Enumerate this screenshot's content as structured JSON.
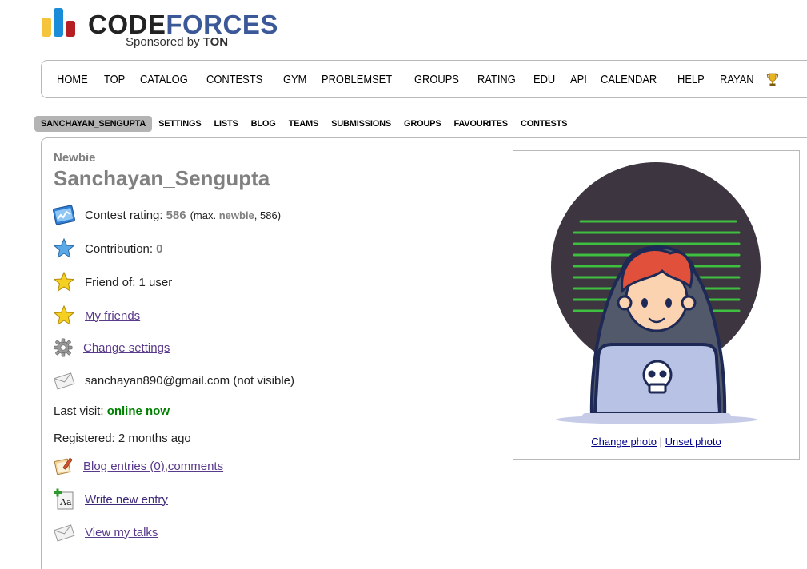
{
  "logo": {
    "brand_part1": "CODE",
    "brand_part2": "FORCES",
    "sponsor_prefix": "Sponsored by ",
    "sponsor_name": "TON",
    "colors": {
      "yellow": "#f6c43c",
      "blue": "#1a8cd8",
      "red": "#b51f24",
      "brand_dark": "#222222",
      "brand_blue": "#3b5998"
    }
  },
  "main_menu": {
    "items": [
      "HOME",
      "TOP",
      "CATALOG",
      "CONTESTS",
      "GYM",
      "PROBLEMSET",
      "GROUPS",
      "RATING",
      "EDU",
      "API",
      "CALENDAR",
      "HELP",
      "RAYAN"
    ],
    "trophy_icon": "trophy-icon"
  },
  "second_menu": {
    "items": [
      "SANCHAYAN_SENGUPTA",
      "SETTINGS",
      "LISTS",
      "BLOG",
      "TEAMS",
      "SUBMISSIONS",
      "GROUPS",
      "FAVOURITES",
      "CONTESTS"
    ],
    "active_index": 0
  },
  "profile": {
    "rank": "Newbie",
    "handle": "Sanchayan_Sengupta",
    "contest_rating_label": "Contest rating: ",
    "contest_rating_value": "586",
    "max_prefix": "(max. ",
    "max_rank": "newbie",
    "max_suffix": ", 586)",
    "contribution_label": "Contribution: ",
    "contribution_value": "0",
    "friend_of": "Friend of: 1 user",
    "my_friends": "My friends",
    "change_settings": "Change settings",
    "email": "sanchayan890@gmail.com (not visible)",
    "last_visit_label": "Last visit: ",
    "last_visit_value": "online now",
    "registered": "Registered: 2 months ago",
    "blog_entries": "Blog entries (0)",
    "comma": ", ",
    "comments": "comments",
    "write_new_entry": "Write new entry",
    "view_my_talks": "View my talks"
  },
  "avatar": {
    "change_photo": "Change photo",
    "separator": " | ",
    "unset_photo": "Unset photo"
  }
}
